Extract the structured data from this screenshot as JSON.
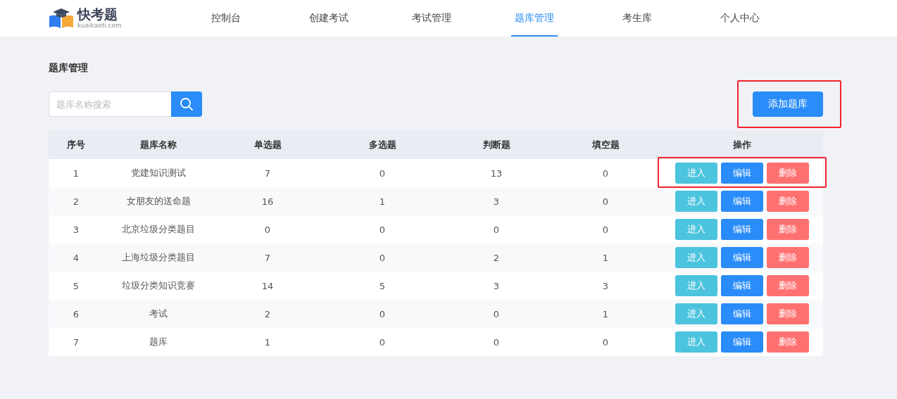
{
  "logo": {
    "name": "快考题",
    "domain": "kuaikaoti.com"
  },
  "nav": [
    {
      "label": "控制台",
      "selected": false
    },
    {
      "label": "创建考试",
      "selected": false
    },
    {
      "label": "考试管理",
      "selected": false
    },
    {
      "label": "题库管理",
      "selected": true
    },
    {
      "label": "考生库",
      "selected": false
    },
    {
      "label": "个人中心",
      "selected": false
    }
  ],
  "page_title": "题库管理",
  "search": {
    "placeholder": "题库名称搜索"
  },
  "add_button": {
    "label": "添加题库",
    "highlighted": true
  },
  "table": {
    "columns": [
      "序号",
      "题库名称",
      "单选题",
      "多选题",
      "判断题",
      "填空题",
      "操作"
    ],
    "rows": [
      {
        "cells": [
          "1",
          "党建知识测试",
          "7",
          "0",
          "13",
          "0"
        ],
        "highlighted": true,
        "actions": [
          {
            "label": "进入",
            "kind": "enter"
          },
          {
            "label": "编辑",
            "kind": "edit"
          },
          {
            "label": "删除",
            "kind": "delete"
          }
        ]
      },
      {
        "cells": [
          "2",
          "女朋友的送命题",
          "16",
          "1",
          "3",
          "0"
        ],
        "highlighted": false,
        "actions": [
          {
            "label": "进入",
            "kind": "enter"
          },
          {
            "label": "编辑",
            "kind": "edit"
          },
          {
            "label": "删除",
            "kind": "delete"
          }
        ]
      },
      {
        "cells": [
          "3",
          "北京垃圾分类题目",
          "0",
          "0",
          "0",
          "0"
        ],
        "highlighted": false,
        "actions": [
          {
            "label": "进入",
            "kind": "enter"
          },
          {
            "label": "编辑",
            "kind": "edit"
          },
          {
            "label": "删除",
            "kind": "delete"
          }
        ]
      },
      {
        "cells": [
          "4",
          "上海垃圾分类题目",
          "7",
          "0",
          "2",
          "1"
        ],
        "highlighted": false,
        "actions": [
          {
            "label": "进入",
            "kind": "enter"
          },
          {
            "label": "编辑",
            "kind": "edit"
          },
          {
            "label": "删除",
            "kind": "delete"
          }
        ]
      },
      {
        "cells": [
          "5",
          "垃圾分类知识竞赛",
          "14",
          "5",
          "3",
          "3"
        ],
        "highlighted": false,
        "actions": [
          {
            "label": "进入",
            "kind": "enter"
          },
          {
            "label": "编辑",
            "kind": "edit"
          },
          {
            "label": "删除",
            "kind": "delete"
          }
        ]
      },
      {
        "cells": [
          "6",
          "考试",
          "2",
          "0",
          "0",
          "1"
        ],
        "highlighted": false,
        "actions": [
          {
            "label": "进入",
            "kind": "enter"
          },
          {
            "label": "编辑",
            "kind": "edit"
          },
          {
            "label": "删除",
            "kind": "delete"
          }
        ]
      },
      {
        "cells": [
          "7",
          "题库",
          "1",
          "0",
          "0",
          "0"
        ],
        "highlighted": false,
        "actions": [
          {
            "label": "进入",
            "kind": "enter"
          },
          {
            "label": "编辑",
            "kind": "edit"
          },
          {
            "label": "删除",
            "kind": "delete"
          }
        ]
      }
    ]
  }
}
